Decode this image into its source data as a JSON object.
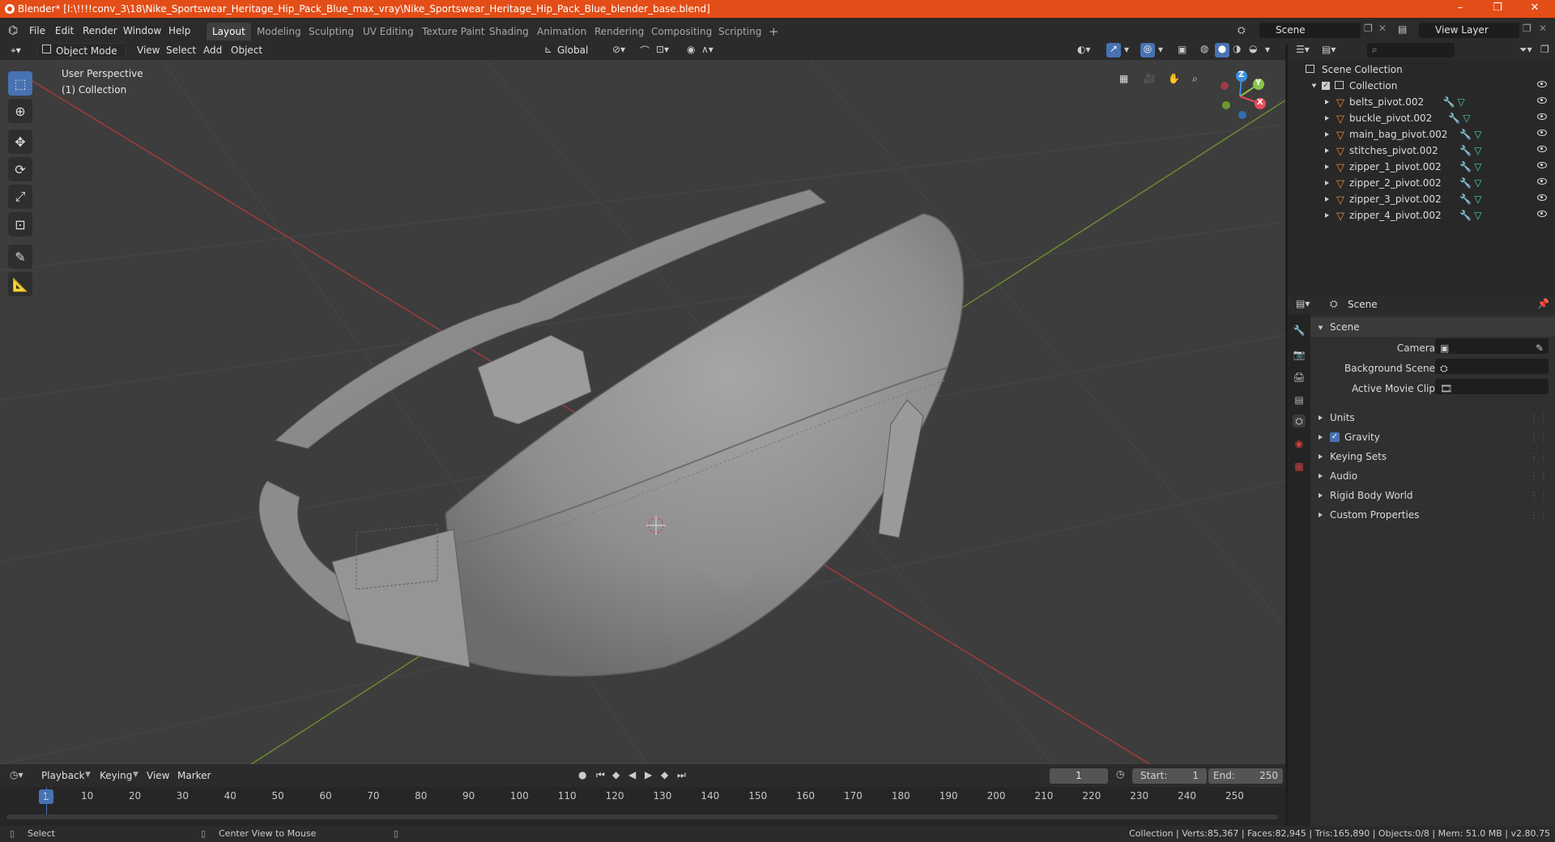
{
  "window": {
    "title": "Blender* [I:\\!!!!conv_3\\18\\Nike_Sportswear_Heritage_Hip_Pack_Blue_max_vray\\Nike_Sportswear_Heritage_Hip_Pack_Blue_blender_base.blend]",
    "controls": [
      "–",
      "❐",
      "✕"
    ]
  },
  "menu": [
    "File",
    "Edit",
    "Render",
    "Window",
    "Help"
  ],
  "workspaces": [
    "Layout",
    "Modeling",
    "Sculpting",
    "UV Editing",
    "Texture Paint",
    "Shading",
    "Animation",
    "Rendering",
    "Compositing",
    "Scripting"
  ],
  "workspace_add": "+",
  "scene_field": "Scene",
  "view_layer_field": "View Layer",
  "viewport": {
    "mode": "Object Mode",
    "menus": [
      "View",
      "Select",
      "Add",
      "Object"
    ],
    "orientation": "Global",
    "perspective_label": "User Perspective",
    "collection_label": "(1) Collection",
    "gizmo_axes": [
      "Z",
      "Y",
      "X"
    ]
  },
  "outliner": {
    "root": "Scene Collection",
    "collection": "Collection",
    "objects": [
      "belts_pivot.002",
      "buckle_pivot.002",
      "main_bag_pivot.002",
      "stitches_pivot.002",
      "zipper_1_pivot.002",
      "zipper_2_pivot.002",
      "zipper_3_pivot.002",
      "zipper_4_pivot.002"
    ]
  },
  "properties": {
    "context": "Scene",
    "panel": "Scene",
    "fields": [
      "Camera",
      "Background Scene",
      "Active Movie Clip"
    ],
    "subpanels": [
      "Units",
      "Gravity",
      "Keying Sets",
      "Audio",
      "Rigid Body World",
      "Custom Properties"
    ],
    "gravity_checked": true
  },
  "timeline": {
    "menus": [
      "Playback",
      "Keying",
      "View",
      "Marker"
    ],
    "current_frame": "1",
    "start_label": "Start:",
    "start": "1",
    "end_label": "End:",
    "end": "250",
    "ticks": [
      "1",
      "10",
      "20",
      "30",
      "40",
      "50",
      "60",
      "70",
      "80",
      "90",
      "100",
      "110",
      "120",
      "130",
      "140",
      "150",
      "160",
      "170",
      "180",
      "190",
      "200",
      "210",
      "220",
      "230",
      "240",
      "250"
    ]
  },
  "status": {
    "left_action": "Select",
    "middle_action": "Center View to Mouse",
    "stats": "Collection | Verts:85,367 | Faces:82,945 | Tris:165,890 | Objects:0/8 | Mem: 51.0 MB | v2.80.75"
  },
  "colors": {
    "accent": "#4772b3",
    "titlebar": "#e34d17",
    "axis_x": "#e84b5b",
    "axis_y": "#8bc34a",
    "axis_z": "#3d8fe0"
  }
}
